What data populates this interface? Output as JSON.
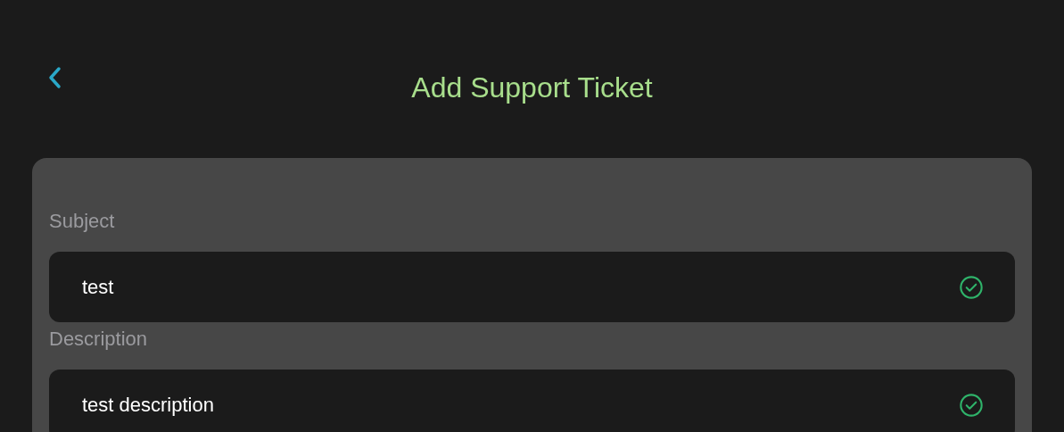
{
  "header": {
    "title": "Add Support Ticket"
  },
  "fields": [
    {
      "label": "Subject",
      "value": "test",
      "valid": true
    },
    {
      "label": "Description",
      "value": "test description",
      "valid": true
    }
  ]
}
